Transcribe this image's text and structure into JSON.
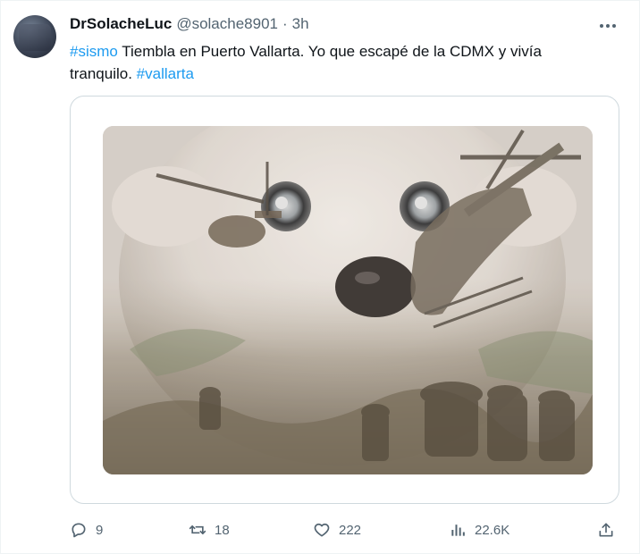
{
  "author": {
    "display_name": "DrSolacheLuc",
    "handle": "@solache8901",
    "separator": "·",
    "timestamp": "3h"
  },
  "tweet": {
    "hashtag_1": "#sismo",
    "body": " Tiembla en Puerto Vallarta. Yo que escapé de la CDMX y vivía tranquilo. ",
    "hashtag_2": "#vallarta"
  },
  "metrics": {
    "replies": "9",
    "retweets": "18",
    "likes": "222",
    "views": "22.6K"
  },
  "icons": {
    "reply": "reply-icon",
    "retweet": "retweet-icon",
    "like": "heart-icon",
    "views": "views-chart-icon",
    "share": "share-icon",
    "more": "more-options-icon"
  },
  "colors": {
    "accent": "#1d9bf0",
    "text": "#0f1419",
    "secondary": "#536471",
    "border": "#cfd9de"
  }
}
